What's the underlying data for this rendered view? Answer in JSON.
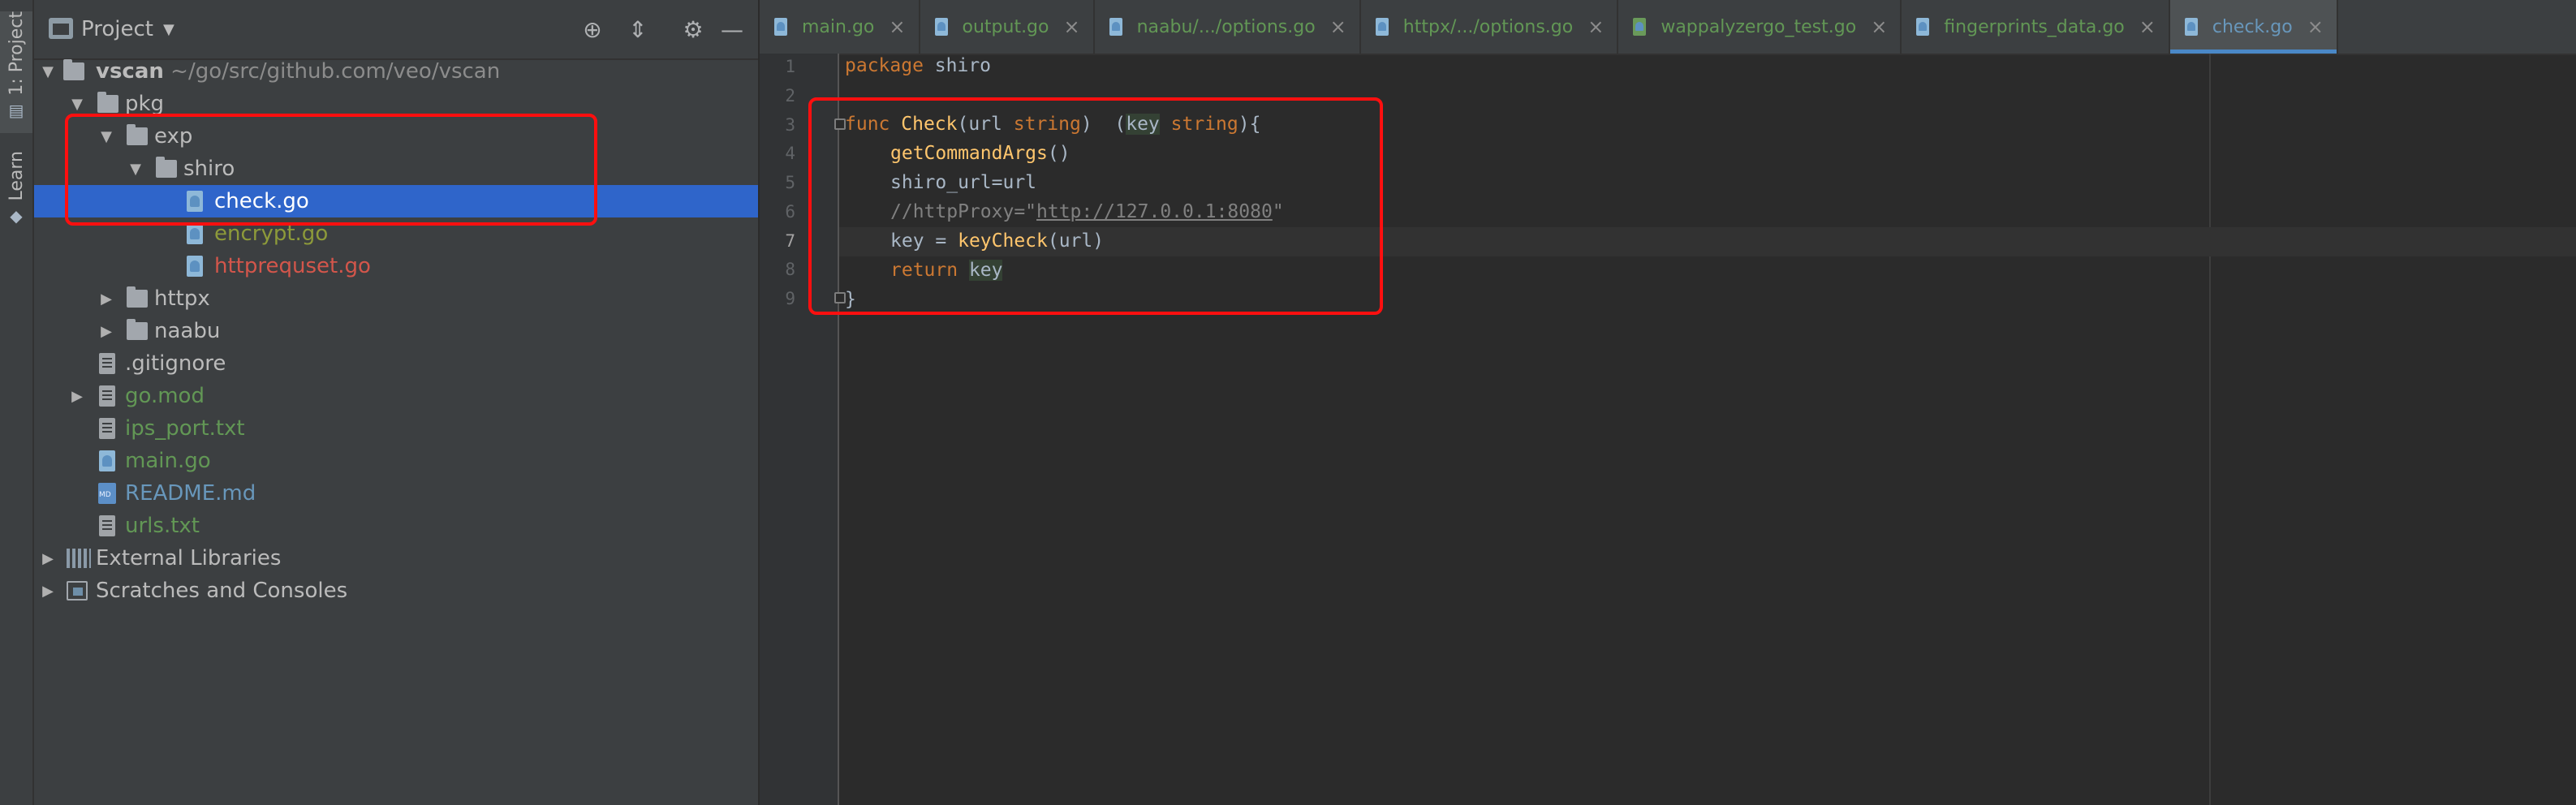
{
  "tool_strip": {
    "project_tab": "1: Project",
    "learn_tab": "Learn"
  },
  "project_panel": {
    "title": "Project",
    "tree": [
      {
        "label": "vscan",
        "hint": "~/go/src/github.com/veo/vscan"
      },
      {
        "label": "pkg"
      },
      {
        "label": "exp"
      },
      {
        "label": "shiro"
      },
      {
        "label": "check.go"
      },
      {
        "label": "encrypt.go"
      },
      {
        "label": "httprequset.go"
      },
      {
        "label": "httpx"
      },
      {
        "label": "naabu"
      },
      {
        "label": ".gitignore"
      },
      {
        "label": "go.mod"
      },
      {
        "label": "ips_port.txt"
      },
      {
        "label": "main.go"
      },
      {
        "label": "README.md"
      },
      {
        "label": "urls.txt"
      },
      {
        "label": "External Libraries"
      },
      {
        "label": "Scratches and Consoles"
      }
    ]
  },
  "editor": {
    "tabs": [
      {
        "label": "main.go"
      },
      {
        "label": "output.go"
      },
      {
        "label": "naabu/.../options.go"
      },
      {
        "label": "httpx/.../options.go"
      },
      {
        "label": "wappalyzergo_test.go"
      },
      {
        "label": "fingerprints_data.go"
      },
      {
        "label": "check.go"
      }
    ],
    "line_numbers": [
      "1",
      "2",
      "3",
      "4",
      "5",
      "6",
      "7",
      "8",
      "9"
    ],
    "code": {
      "l1_kw": "package",
      "l1_rest": " shiro",
      "l3_kw": "func ",
      "l3_fn": "Check",
      "l3_a": "(url ",
      "l3_t1": "string",
      "l3_b": ")  (",
      "l3_key": "key",
      "l3_sp": " ",
      "l3_t2": "string",
      "l3_c": "){",
      "l4_fn": "getCommandArgs",
      "l4_rest": "()",
      "l5": "shiro_url=url",
      "l6_a": "//httpProxy=\"",
      "l6_url": "http://127.0.0.1:8080",
      "l6_b": "\"",
      "l7_a": "key = ",
      "l7_fn": "keyCheck",
      "l7_b": "(url)",
      "l8_kw": "return ",
      "l8_key": "key",
      "l9": "}"
    }
  },
  "colors": {
    "annotation_red": "#ff0f0f",
    "selection_blue": "#2f65ca",
    "vcs_added_green": "#629755",
    "vcs_modified_blue": "#6897bb",
    "vcs_conflict_red": "#d3564b"
  }
}
